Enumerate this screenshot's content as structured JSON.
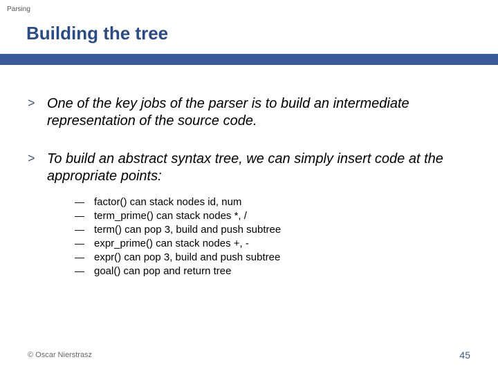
{
  "topic": "Parsing",
  "title": "Building the tree",
  "bullets": [
    {
      "text": "One of the key jobs of the parser is to build an intermediate representation of the source code.",
      "subs": []
    },
    {
      "text": "To build an abstract syntax tree, we can simply insert code at the appropriate points:",
      "subs": [
        "factor() can stack nodes id, num",
        "term_prime() can stack nodes *, /",
        "term() can pop 3, build and push subtree",
        "expr_prime() can stack nodes +, -",
        "expr() can pop 3, build and push subtree",
        "goal() can pop and return tree"
      ]
    }
  ],
  "footer": {
    "copyright": "© Oscar Nierstrasz",
    "page": "45"
  },
  "glyphs": {
    "angle": ">",
    "dash": "—"
  }
}
